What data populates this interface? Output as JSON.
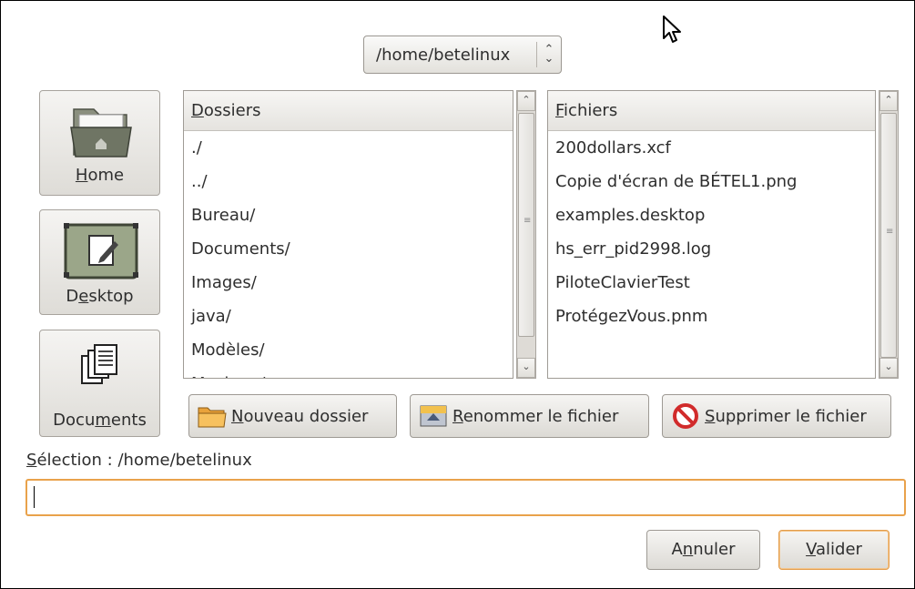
{
  "path_combo": {
    "value": "/home/betelinux"
  },
  "places": [
    {
      "pre": "",
      "mn": "H",
      "post": "ome",
      "icon": "home-folder-icon"
    },
    {
      "pre": "D",
      "mn": "e",
      "post": "sktop",
      "icon": "desktop-icon"
    },
    {
      "pre": "Docu",
      "mn": "m",
      "post": "ents",
      "icon": "documents-icon"
    }
  ],
  "folders": {
    "header_mn": "D",
    "header_rest": "ossiers",
    "items": [
      "./",
      "../",
      "Bureau/",
      "Documents/",
      "Images/",
      "java/",
      "Modèles/",
      "Musique/"
    ]
  },
  "files": {
    "header_mn": "F",
    "header_rest": "ichiers",
    "items": [
      "200dollars.xcf",
      "Copie d'écran de BÉTEL1.png",
      "examples.desktop",
      "hs_err_pid2998.log",
      "PiloteClavierTest",
      "ProtégezVous.pnm"
    ]
  },
  "actions": {
    "new_folder": {
      "mn": "N",
      "rest": "ouveau dossier"
    },
    "rename": {
      "mn": "R",
      "rest": "enommer le fichier"
    },
    "delete": {
      "mn": "S",
      "rest": "upprimer le fichier"
    }
  },
  "selection": {
    "mn": "S",
    "rest": "élection : /home/betelinux",
    "value": ""
  },
  "buttons": {
    "cancel": {
      "pre": "A",
      "mn": "n",
      "post": "nuler"
    },
    "ok": {
      "pre": "",
      "mn": "V",
      "post": "alider"
    }
  }
}
